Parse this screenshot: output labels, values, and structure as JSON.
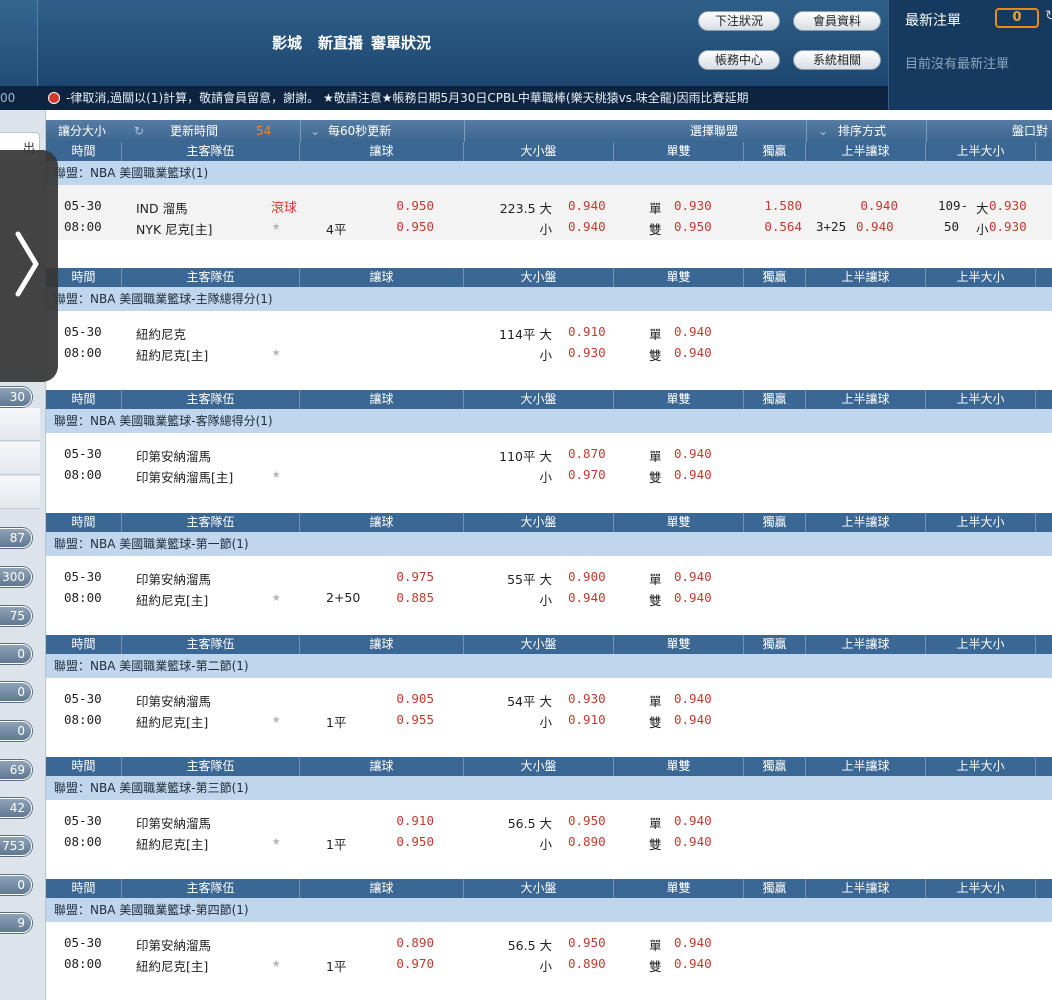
{
  "header": {
    "nav": [
      "影城",
      "新直播",
      "審單狀況"
    ],
    "buttons": {
      "bet_status": "下注狀況",
      "member_info": "會員資料",
      "account_center": "帳務中心",
      "system": "系統相關"
    },
    "latest": {
      "title": "最新注單",
      "count": "0",
      "empty_text": "目前沒有最新注單"
    }
  },
  "marquee": {
    "left_num": "00",
    "text": "-律取消,過關以(1)計算，敬請會員留意，謝謝。 ★敬請注意★帳務日期5月30日CPBL中華職棒(樂天桃猿vs.味全龍)因雨比賽延期"
  },
  "sidebar": {
    "top_label": "出",
    "pills": [
      "30",
      "87",
      "300",
      "75",
      "0",
      "0",
      "0",
      "69",
      "42",
      "753",
      "0",
      "9"
    ]
  },
  "toolbar": {
    "handicap_size": "讓分大小",
    "update_time": "更新時間",
    "countdown": "54",
    "refresh": "每60秒更新",
    "select_league": "選擇聯盟",
    "sort": "排序方式",
    "handicap_compare": "盤口對"
  },
  "columns": [
    "時間",
    "主客隊伍",
    "讓球",
    "大小盤",
    "單雙",
    "獨贏",
    "上半讓球",
    "上半大小"
  ],
  "colors": {
    "header_bg": "#1c4670",
    "league_bg": "#c0d6ec",
    "odds_red": "#c23b2e",
    "live_red": "#e03a2e"
  },
  "sections": [
    {
      "league": "聯盟：NBA 美國職業籃球(1)",
      "date": "05-30",
      "time": "08:00",
      "team1": "IND 溜馬",
      "team2": "NYK 尼克[主]",
      "live": "滾球",
      "hcap_line": "4平",
      "hcap_odds1": "0.950",
      "hcap_odds2": "0.950",
      "ou_line": "223.5 大",
      "ou_over": "0.940",
      "ou_under_label": "小",
      "ou_under": "0.940",
      "odd_label": "單",
      "odd": "0.930",
      "even_label": "雙",
      "even": "0.950",
      "ml1": "1.580",
      "ml2": "0.564",
      "h1_hcap1": "0.940",
      "h1_hcap_line": "3+25",
      "h1_hcap2": "0.940",
      "h1_ou_line1": "109-",
      "h1_ou_over_label": "大",
      "h1_ou_over": "0.930",
      "h1_ou_line2": "50",
      "h1_ou_under_label": "小",
      "h1_ou_under": "0.930"
    },
    {
      "league": "聯盟：NBA 美國職業籃球-主隊總得分(1)",
      "date": "05-30",
      "time": "08:00",
      "team1": "紐約尼克",
      "team2": "紐約尼克[主]",
      "ou_line": "114平 大",
      "ou_over": "0.910",
      "ou_under_label": "小",
      "ou_under": "0.930",
      "odd_label": "單",
      "odd": "0.940",
      "even_label": "雙",
      "even": "0.940"
    },
    {
      "league": "聯盟：NBA 美國職業籃球-客隊總得分(1)",
      "date": "05-30",
      "time": "08:00",
      "team1": "印第安納溜馬",
      "team2": "印第安納溜馬[主]",
      "ou_line": "110平 大",
      "ou_over": "0.870",
      "ou_under_label": "小",
      "ou_under": "0.970",
      "odd_label": "單",
      "odd": "0.940",
      "even_label": "雙",
      "even": "0.940"
    },
    {
      "league": "聯盟：NBA 美國職業籃球-第一節(1)",
      "date": "05-30",
      "time": "08:00",
      "team1": "印第安納溜馬",
      "team2": "紐約尼克[主]",
      "hcap_line": "2+50",
      "hcap_odds1": "0.975",
      "hcap_odds2": "0.885",
      "ou_line": "55平 大",
      "ou_over": "0.900",
      "ou_under_label": "小",
      "ou_under": "0.940",
      "odd_label": "單",
      "odd": "0.940",
      "even_label": "雙",
      "even": "0.940"
    },
    {
      "league": "聯盟：NBA 美國職業籃球-第二節(1)",
      "date": "05-30",
      "time": "08:00",
      "team1": "印第安納溜馬",
      "team2": "紐約尼克[主]",
      "hcap_line": "1平",
      "hcap_odds1": "0.905",
      "hcap_odds2": "0.955",
      "ou_line": "54平 大",
      "ou_over": "0.930",
      "ou_under_label": "小",
      "ou_under": "0.910",
      "odd_label": "單",
      "odd": "0.940",
      "even_label": "雙",
      "even": "0.940"
    },
    {
      "league": "聯盟：NBA 美國職業籃球-第三節(1)",
      "date": "05-30",
      "time": "08:00",
      "team1": "印第安納溜馬",
      "team2": "紐約尼克[主]",
      "hcap_line": "1平",
      "hcap_odds1": "0.910",
      "hcap_odds2": "0.950",
      "ou_line": "56.5 大",
      "ou_over": "0.950",
      "ou_under_label": "小",
      "ou_under": "0.890",
      "odd_label": "單",
      "odd": "0.940",
      "even_label": "雙",
      "even": "0.940"
    },
    {
      "league": "聯盟：NBA 美國職業籃球-第四節(1)",
      "date": "05-30",
      "time": "08:00",
      "team1": "印第安納溜馬",
      "team2": "紐約尼克[主]",
      "hcap_line": "1平",
      "hcap_odds1": "0.890",
      "hcap_odds2": "0.970",
      "ou_line": "56.5 大",
      "ou_over": "0.950",
      "ou_under_label": "小",
      "ou_under": "0.890",
      "odd_label": "單",
      "odd": "0.940",
      "even_label": "雙",
      "even": "0.940"
    }
  ]
}
